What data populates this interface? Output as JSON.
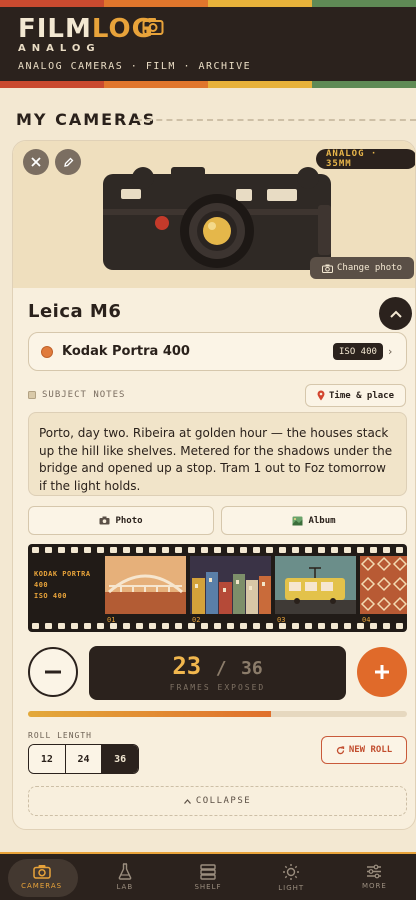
{
  "header": {
    "logo_a": "FILM",
    "logo_b": "LOG",
    "subtitle": "ANALOG",
    "tagline": "ANALOG CAMERAS · FILM · ARCHIVE",
    "stripe_colors": [
      "#c94a2f",
      "#e0762c",
      "#e8b23a",
      "#5f8a55"
    ]
  },
  "section": {
    "title": "MY CAMERAS"
  },
  "camera": {
    "badge": "ANALOG · 35MM",
    "change_photo": "Change photo",
    "name": "Leica M6",
    "film": {
      "name": "Kodak Portra 400",
      "iso": "ISO 400",
      "dot_color": "#e07b3c"
    },
    "notes_label": "SUBJECT NOTES",
    "time_place": "Time & place",
    "notes": "Porto, day two. Ribeira at golden hour — the houses stack up the hill like shelves. Metered for the shadows under the bridge and opened up a stop. Tram 1 out to Foz tomorrow if the light holds.",
    "photo_btn": "Photo",
    "album_btn": "Album",
    "strip": {
      "label_lines": [
        "KODAK PORTRA",
        "400",
        "ISO 400"
      ],
      "frames": [
        "01",
        "02",
        "03",
        "04"
      ]
    },
    "counter": {
      "exposed": "23",
      "separator": "/",
      "total": "36",
      "label": "FRAMES EXPOSED",
      "progress": 0.64
    },
    "roll_length": {
      "label": "ROLL LENGTH",
      "options": [
        "12",
        "24",
        "36"
      ],
      "selected": "36"
    },
    "new_roll": "NEW ROLL",
    "collapse": "COLLAPSE"
  },
  "nav": {
    "items": [
      {
        "label": "CAMERAS",
        "icon": "camera-icon",
        "active": true
      },
      {
        "label": "LAB",
        "icon": "flask-icon",
        "active": false
      },
      {
        "label": "SHELF",
        "icon": "shelf-icon",
        "active": false
      },
      {
        "label": "LIGHT",
        "icon": "sun-icon",
        "active": false
      },
      {
        "label": "MORE",
        "icon": "sliders-icon",
        "active": false
      }
    ]
  }
}
